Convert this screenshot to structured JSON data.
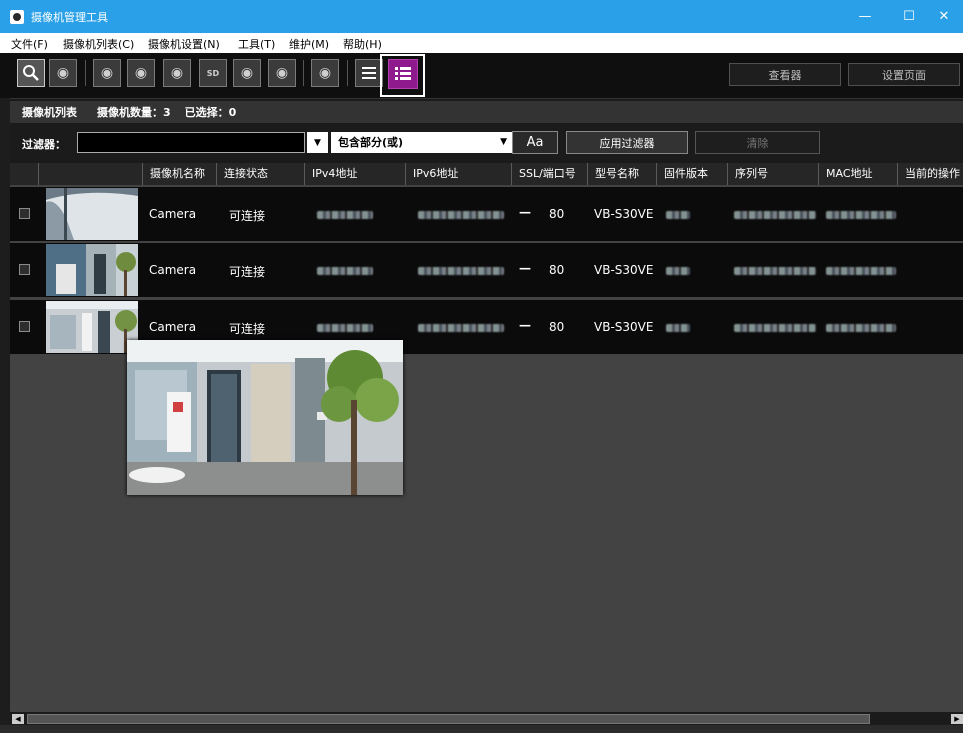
{
  "window": {
    "title": "摄像机管理工具",
    "minimize": "—",
    "maximize": "☐",
    "close": "✕"
  },
  "menu": [
    "文件(F)",
    "摄像机列表(C)",
    "摄像机设置(N)",
    "工具(T)",
    "维护(M)",
    "帮助(H)"
  ],
  "toolbar": {
    "viewer_label": "查看器",
    "settings_label": "设置页面"
  },
  "info": {
    "list_label": "摄像机列表",
    "count_label": "摄像机数量：3",
    "selected_label": "已选择：0"
  },
  "filter": {
    "label": "过滤器：",
    "input_value": "",
    "mode_value": "包含部分(或)",
    "case_button": "Aa",
    "apply_button": "应用过滤器",
    "clear_button": "清除"
  },
  "table": {
    "columns": [
      "摄像机名称",
      "连接状态",
      "IPv4地址",
      "IPv6地址",
      "SSL/端口号",
      "型号名称",
      "固件版本",
      "序列号",
      "MAC地址",
      "当前的操作"
    ],
    "rows": [
      {
        "name": "Camera",
        "status": "可连接",
        "ssl": "—",
        "port": "80",
        "model": "VB-S30VE"
      },
      {
        "name": "Camera",
        "status": "可连接",
        "ssl": "—",
        "port": "80",
        "model": "VB-S30VE"
      },
      {
        "name": "Camera",
        "status": "可连接",
        "ssl": "—",
        "port": "80",
        "model": "VB-S30VE"
      }
    ]
  },
  "colors": {
    "titlebar": "#2aa0e8",
    "active_toggle": "#8e1a8e"
  }
}
